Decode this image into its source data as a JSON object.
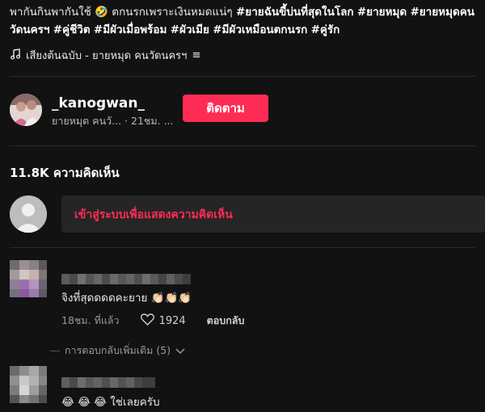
{
  "caption": {
    "text": "พากันกินพากันใช้ 🤣 ตกนรกเพราะเงินหมดแน่ๆ",
    "hashtags": [
      "#ยายฉันขี้บ่นที่สุดในโลก",
      "#ยายหมุด",
      "#ยายหมุดคนวัดนครฯ",
      "#คู่ชีวิต",
      "#มีผัวเมื่อพร้อม",
      "#ผัวเมีย",
      "#มีผัวเหมือนตกนรก",
      "#คู่รัก"
    ]
  },
  "music": {
    "icon": "music-note-icon",
    "text": "เสียงต้นฉบับ - ยายหมุด คนวัดนครฯ",
    "menu_glyph": "≡"
  },
  "author": {
    "username": "_kanogwan_",
    "subtitle": "ยายหมุด คนวั... · 21ชม. ..."
  },
  "follow_label": "ติดตาม",
  "comments_count_label": "11.8K ความคิดเห็น",
  "login_prompt": "เข้าสู่ระบบเพื่อแสดงความคิดเห็น",
  "comments": [
    {
      "text": "จิงที่สุดดดดคะยาย 👏🏻👏🏻👏🏻",
      "time": "18ชม. ที่แล้ว",
      "likes": "1924",
      "reply_label": "ตอบกลับ",
      "more_replies_label": "การตอบกลับเพิ่มเติม (5)"
    },
    {
      "text": "😂 😂 😂 ใช่เลยครับ"
    }
  ],
  "colors": {
    "background": "#121212",
    "accent": "#fe2c55",
    "input_bg": "#252525"
  }
}
